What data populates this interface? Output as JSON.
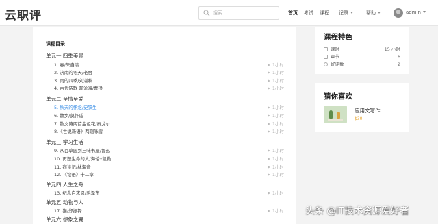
{
  "header": {
    "logo": "云职评",
    "search_placeholder": "搜索",
    "nav": [
      "首页",
      "考试",
      "课程",
      "记录",
      "帮助"
    ],
    "user": "admin"
  },
  "catalog": {
    "title": "课程目录",
    "units": [
      {
        "label": "单元一 四季美景",
        "lessons": [
          {
            "label": "1. 春/朱自清",
            "duration": "1小时"
          },
          {
            "label": "2. 济南的冬天/老舍",
            "duration": "1小时"
          },
          {
            "label": "3. 雨的四季/刘湛秋",
            "duration": "1小时"
          },
          {
            "label": "4. 古代诗歌 观沧海/曹操",
            "duration": "1小时"
          }
        ]
      },
      {
        "label": "单元二 至情至爱",
        "lessons": [
          {
            "label": "5. 秋天的怀念/史铁生",
            "duration": "1小时",
            "current": true
          },
          {
            "label": "6. 散步/莫怀戚",
            "duration": "1小时"
          },
          {
            "label": "7. 散文诗两首金色花/泰戈尔",
            "duration": "1小时"
          },
          {
            "label": "8.《世说新语》两则咏雪",
            "duration": "1小时"
          }
        ]
      },
      {
        "label": "单元三 学习生活",
        "lessons": [
          {
            "label": "9. 从百草园到三味书屋/鲁迅",
            "duration": "1小时"
          },
          {
            "label": "10. 再塑生命的人/海伦•凯勒",
            "duration": "1小时"
          },
          {
            "label": "11. 窃读记/林海音",
            "duration": "1小时"
          },
          {
            "label": "12. 《论语》十二章",
            "duration": "1小时"
          }
        ]
      },
      {
        "label": "单元四 人生之舟",
        "lessons": [
          {
            "label": "13. 纪念白求恩/毛泽东",
            "duration": "1小时"
          }
        ]
      },
      {
        "label": "单元五 动物与人",
        "lessons": [
          {
            "label": "17. 猫/郑振铎",
            "duration": "1小时"
          }
        ]
      },
      {
        "label": "单元六 想象之翼",
        "lessons": []
      }
    ]
  },
  "features": {
    "title": "课程特色",
    "stats": [
      {
        "label": "课时",
        "value": "15 小时"
      },
      {
        "label": "章节",
        "value": "6"
      },
      {
        "label": "好评数",
        "value": "2"
      }
    ]
  },
  "recommend": {
    "title": "猜你喜欢",
    "item_name": "应用文写作",
    "item_price": "$30"
  },
  "watermark": "头条 @IT技术资源爱好者"
}
